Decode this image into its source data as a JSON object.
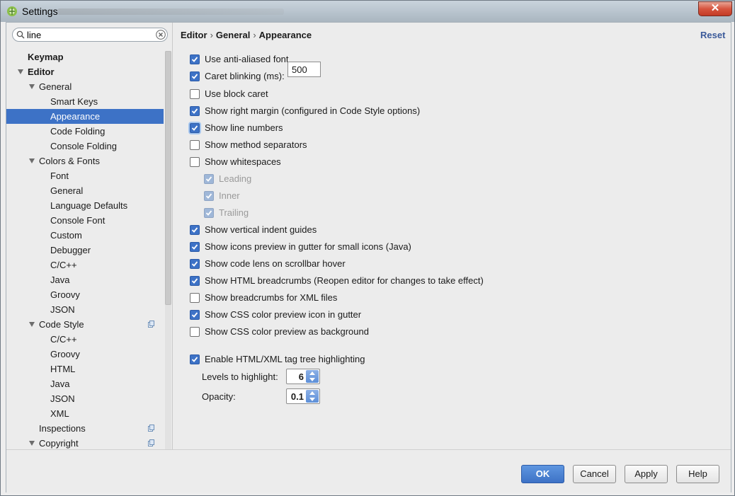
{
  "window": {
    "title": "Settings"
  },
  "search": {
    "value": "line"
  },
  "tree": [
    {
      "label": "Keymap",
      "level": 0,
      "bold": true
    },
    {
      "label": "Editor",
      "level": 0,
      "bold": true,
      "expanded": true
    },
    {
      "label": "General",
      "level": 1,
      "expanded": true
    },
    {
      "label": "Smart Keys",
      "level": 2
    },
    {
      "label": "Appearance",
      "level": 2,
      "selected": true
    },
    {
      "label": "Code Folding",
      "level": 2
    },
    {
      "label": "Console Folding",
      "level": 2
    },
    {
      "label": "Colors & Fonts",
      "level": 1,
      "expanded": true
    },
    {
      "label": "Font",
      "level": 2
    },
    {
      "label": "General",
      "level": 2
    },
    {
      "label": "Language Defaults",
      "level": 2
    },
    {
      "label": "Console Font",
      "level": 2
    },
    {
      "label": "Custom",
      "level": 2
    },
    {
      "label": "Debugger",
      "level": 2
    },
    {
      "label": "C/C++",
      "level": 2
    },
    {
      "label": "Java",
      "level": 2
    },
    {
      "label": "Groovy",
      "level": 2
    },
    {
      "label": "JSON",
      "level": 2
    },
    {
      "label": "Code Style",
      "level": 1,
      "expanded": true,
      "badge": true
    },
    {
      "label": "C/C++",
      "level": 2
    },
    {
      "label": "Groovy",
      "level": 2
    },
    {
      "label": "HTML",
      "level": 2
    },
    {
      "label": "Java",
      "level": 2
    },
    {
      "label": "JSON",
      "level": 2
    },
    {
      "label": "XML",
      "level": 2
    },
    {
      "label": "Inspections",
      "level": 1,
      "badge": true
    },
    {
      "label": "Copyright",
      "level": 1,
      "expanded": true,
      "badge": true
    }
  ],
  "breadcrumb": [
    "Editor",
    "General",
    "Appearance"
  ],
  "breadcrumb_sep": "›",
  "reset_label": "Reset",
  "options": [
    {
      "label": "Use anti-aliased font",
      "checked": true
    },
    {
      "label": "Caret blinking (ms):",
      "checked": true
    },
    {
      "label": "Use block caret",
      "checked": false
    },
    {
      "label": "Show right margin (configured in Code Style options)",
      "checked": true
    },
    {
      "label": "Show line numbers",
      "checked": true,
      "focused": true
    },
    {
      "label": "Show method separators",
      "checked": false
    },
    {
      "label": "Show whitespaces",
      "checked": false
    },
    {
      "label": "Leading",
      "checked": true,
      "disabled": true
    },
    {
      "label": "Inner",
      "checked": true,
      "disabled": true
    },
    {
      "label": "Trailing",
      "checked": true,
      "disabled": true
    },
    {
      "label": "Show vertical indent guides",
      "checked": true
    },
    {
      "label": "Show icons preview in gutter for small icons (Java)",
      "checked": true
    },
    {
      "label": "Show code lens on scrollbar hover",
      "checked": true
    },
    {
      "label": "Show HTML breadcrumbs (Reopen editor for changes to take effect)",
      "checked": true
    },
    {
      "label": "Show breadcrumbs for XML files",
      "checked": false
    },
    {
      "label": "Show CSS color preview icon in gutter",
      "checked": true
    },
    {
      "label": "Show CSS color preview as background",
      "checked": false
    },
    {
      "label": "Enable HTML/XML tag tree highlighting",
      "checked": true
    }
  ],
  "caret_blinking_value": "500",
  "levels": {
    "label": "Levels to highlight:",
    "value": "6"
  },
  "opacity": {
    "label": "Opacity:",
    "value": "0.1"
  },
  "buttons": {
    "ok": "OK",
    "cancel": "Cancel",
    "apply": "Apply",
    "help": "Help"
  },
  "colors": {
    "accent": "#3d72c6",
    "close": "#c9462f"
  }
}
